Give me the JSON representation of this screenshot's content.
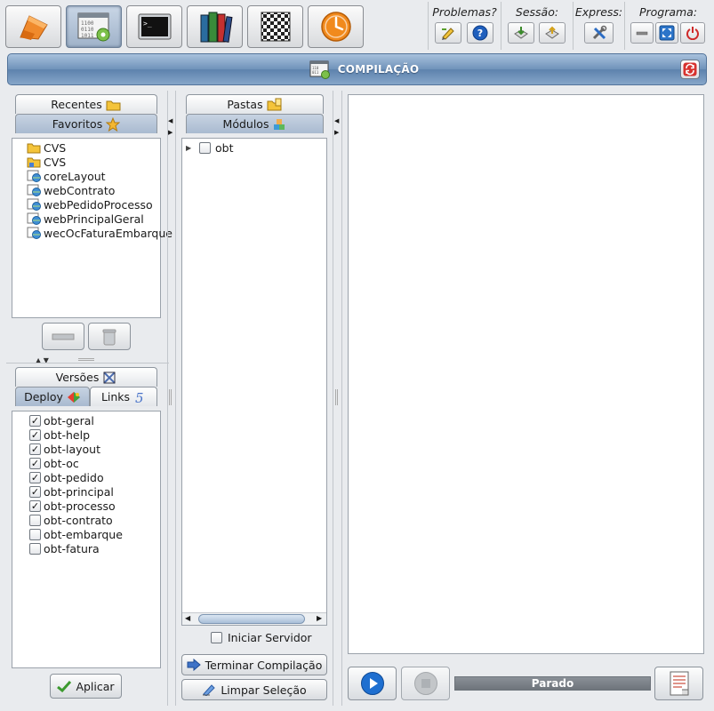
{
  "toolbar": {
    "buttons": [
      {
        "name": "home",
        "icon": "orange-cube-icon"
      },
      {
        "name": "compilation",
        "icon": "build-config-icon"
      },
      {
        "name": "terminal",
        "icon": "terminal-icon",
        "glyph": ">_"
      },
      {
        "name": "library",
        "icon": "books-icon"
      },
      {
        "name": "board",
        "icon": "checkerboard-icon"
      },
      {
        "name": "clock",
        "icon": "clock-icon"
      }
    ],
    "groups": {
      "problems": "Problemas?",
      "session": "Sessão:",
      "express": "Express:",
      "program": "Programa:"
    }
  },
  "header": {
    "title": "COMPILAÇÃO"
  },
  "left": {
    "tabs_top": {
      "recent": "Recentes",
      "favorites": "Favoritos"
    },
    "favorites": [
      {
        "label": "CVS",
        "icon": "folder-icon"
      },
      {
        "label": "CVS",
        "icon": "folder-locked-icon"
      },
      {
        "label": "coreLayout",
        "icon": "web-module-icon"
      },
      {
        "label": "webContrato",
        "icon": "web-module-icon"
      },
      {
        "label": "webPedidoProcesso",
        "icon": "web-module-icon"
      },
      {
        "label": "webPrincipalGeral",
        "icon": "web-module-icon"
      },
      {
        "label": "wecOcFaturaEmbarque",
        "icon": "web-module-icon"
      }
    ],
    "tabs_bottom": {
      "versions": "Versões",
      "deploy": "Deploy",
      "links": "Links"
    },
    "deploy_items": [
      {
        "label": "obt-geral",
        "checked": true
      },
      {
        "label": "obt-help",
        "checked": true
      },
      {
        "label": "obt-layout",
        "checked": true
      },
      {
        "label": "obt-oc",
        "checked": true
      },
      {
        "label": "obt-pedido",
        "checked": true
      },
      {
        "label": "obt-principal",
        "checked": true
      },
      {
        "label": "obt-processo",
        "checked": true
      },
      {
        "label": "obt-contrato",
        "checked": false
      },
      {
        "label": "obt-embarque",
        "checked": false
      },
      {
        "label": "obt-fatura",
        "checked": false
      }
    ],
    "apply_label": "Aplicar"
  },
  "middle": {
    "tabs": {
      "folders": "Pastas",
      "modules": "Módulos"
    },
    "tree": [
      {
        "label": "obt",
        "expanded": false,
        "checked": false
      }
    ],
    "start_server_label": "Iniciar Servidor",
    "start_server_checked": false,
    "finish_label": "Terminar Compilação",
    "clear_label": "Limpar Seleção"
  },
  "right": {
    "status_text": "Parado"
  },
  "colors": {
    "header_blue": "#6f92ba",
    "play_blue": "#1e6fd0",
    "refresh_red": "#d7322e"
  }
}
